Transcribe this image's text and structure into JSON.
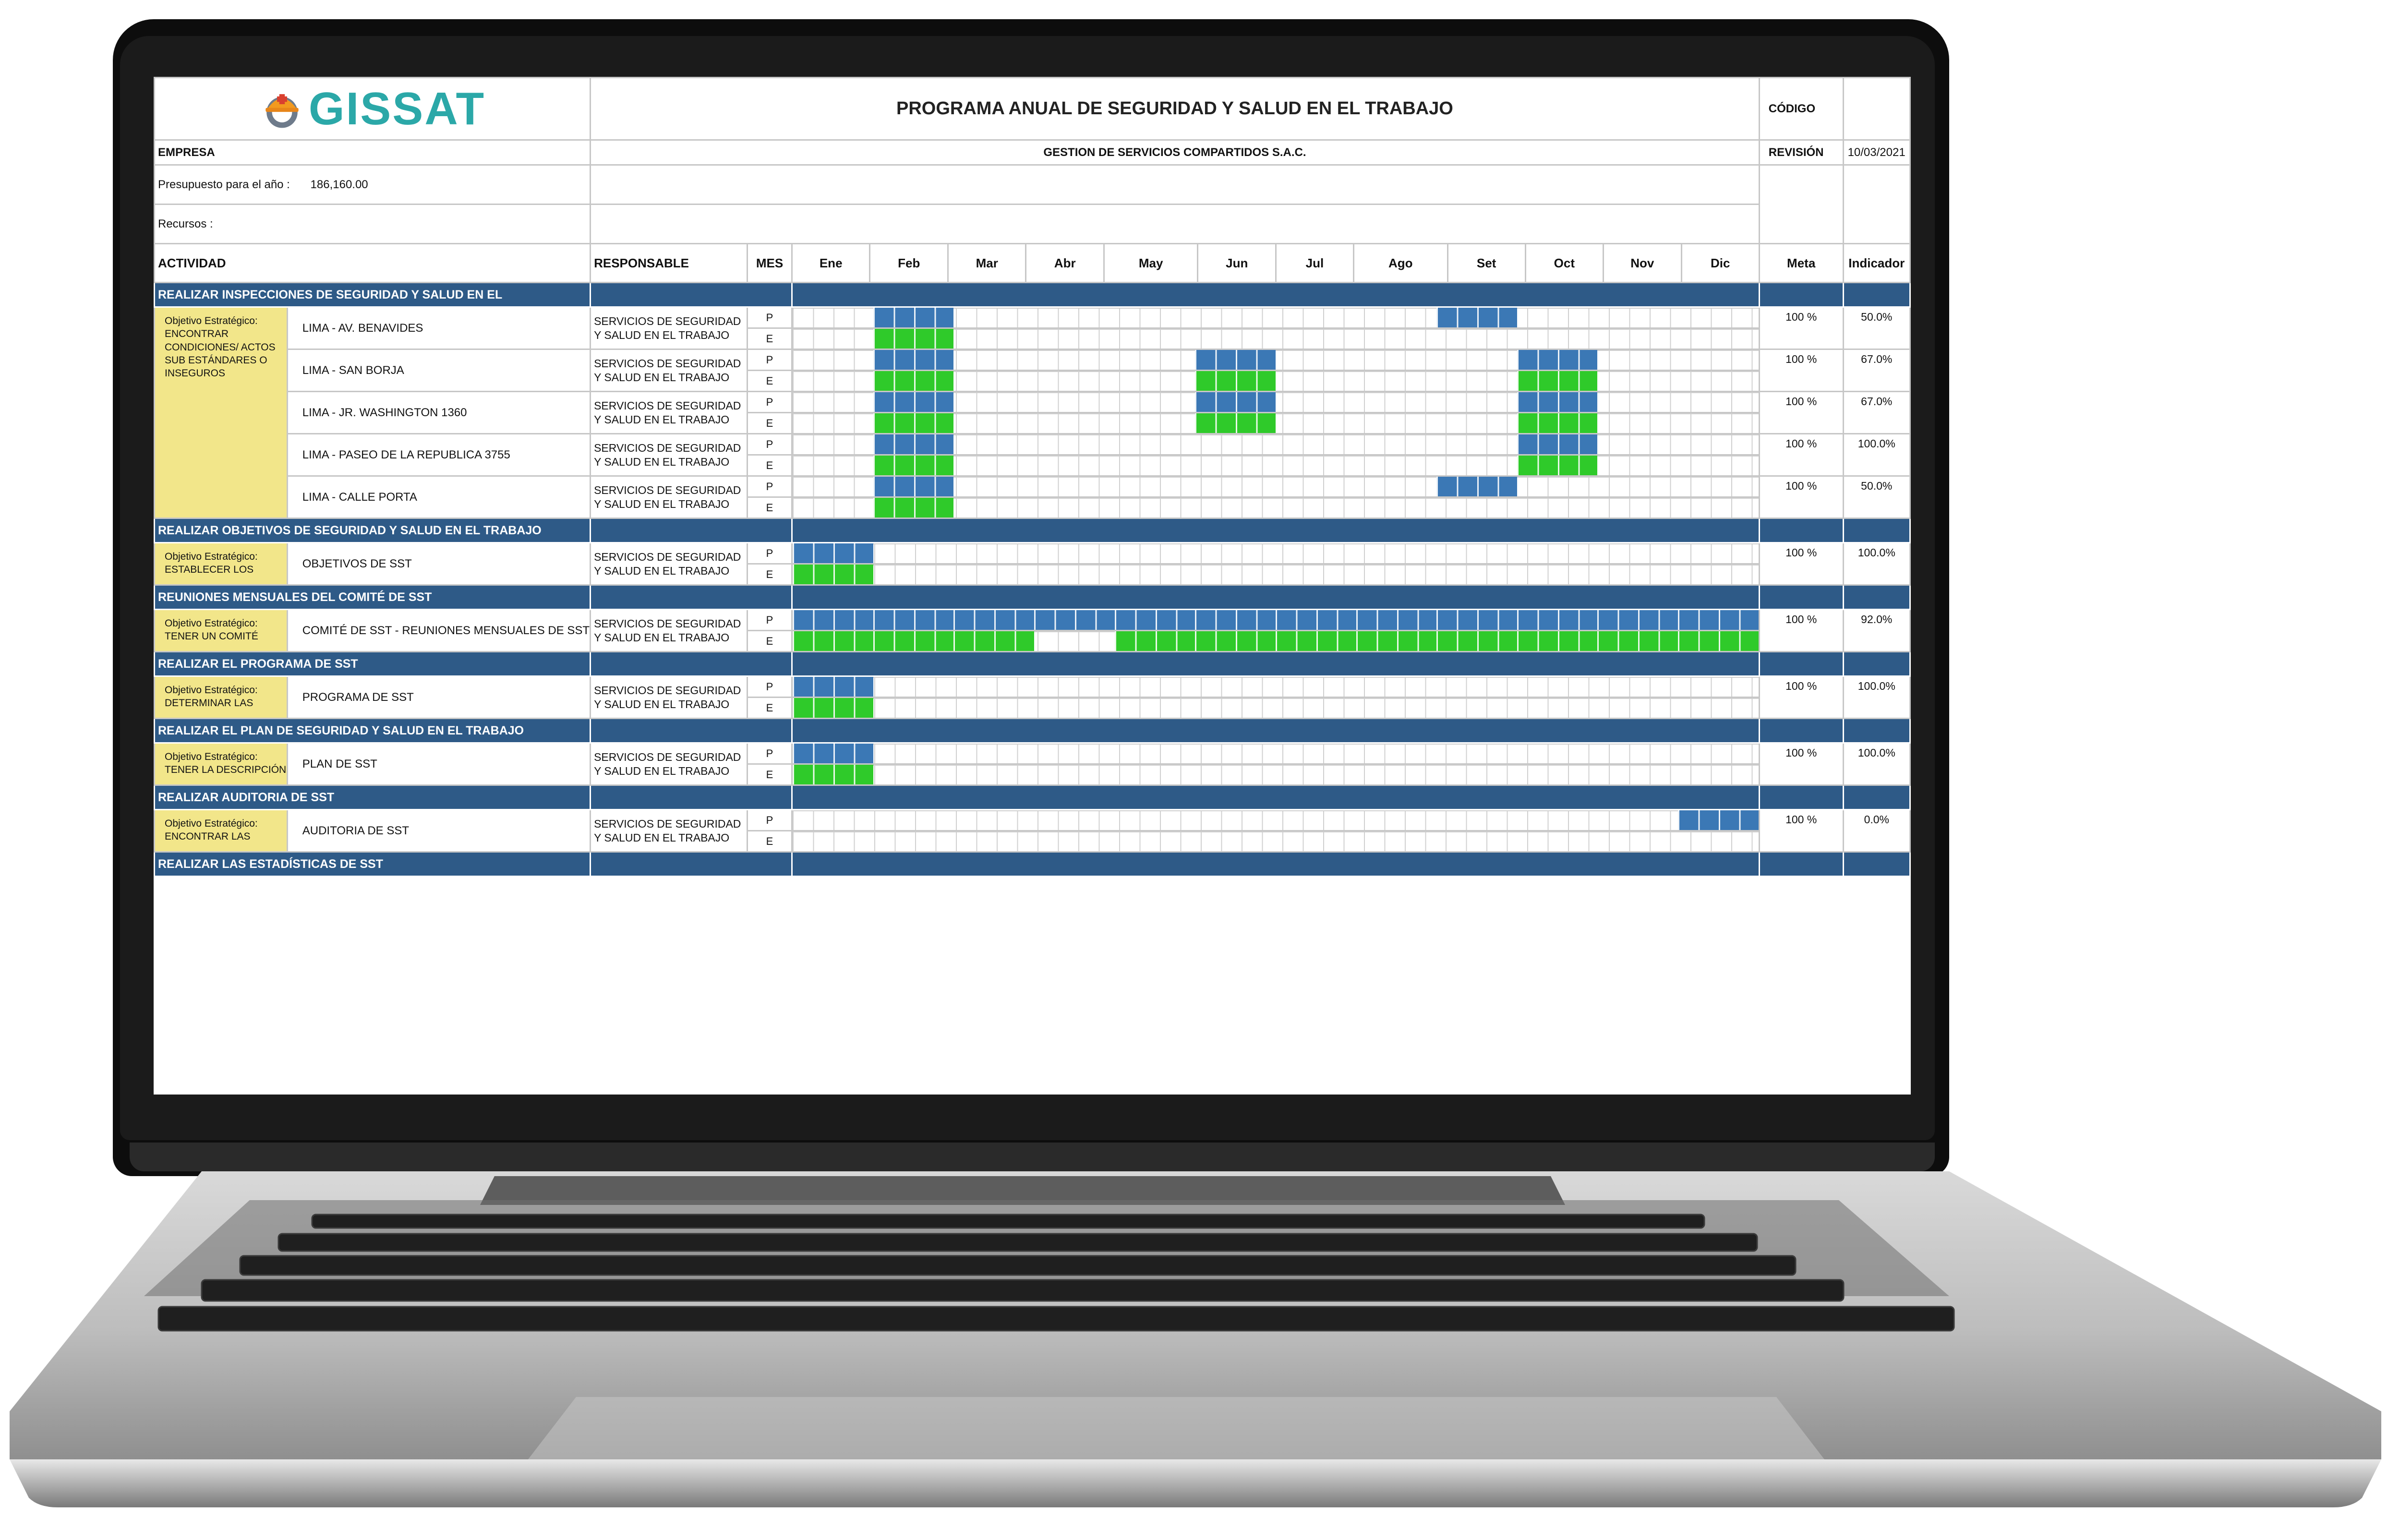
{
  "header": {
    "logo_text": "GISSAT",
    "title": "PROGRAMA ANUAL DE SEGURIDAD Y SALUD EN EL TRABAJO",
    "codigo_label": "CÓDIGO",
    "codigo_value": "",
    "empresa_label": "EMPRESA",
    "empresa_value": "GESTION DE SERVICIOS COMPARTIDOS S.A.C.",
    "revision_label": "REVISIÓN",
    "revision_value": "10/03/2021",
    "presupuesto_label": "Presupuesto para el año :",
    "presupuesto_value": "186,160.00",
    "recursos_label": "Recursos :"
  },
  "columns": {
    "actividad": "ACTIVIDAD",
    "responsable": "RESPONSABLE",
    "mes": "MES",
    "months": [
      "Ene",
      "Feb",
      "Mar",
      "Abr",
      "May",
      "Jun",
      "Jul",
      "Ago",
      "Set",
      "Oct",
      "Nov",
      "Dic"
    ],
    "meta": "Meta",
    "indicador": "Indicador"
  },
  "colors": {
    "section_bg": "#2e5a87",
    "planned": "#3b78b5",
    "executed": "#2fca2a",
    "objective_bg": "#f2e68a",
    "logo": "#2ba8a8"
  },
  "sections": [
    {
      "title": "REALIZAR INSPECCIONES DE SEGURIDAD Y SALUD EN EL",
      "objective": "Objetivo Estratégico: ENCONTRAR CONDICIONES/ ACTOS SUB ESTÁNDARES O INSEGUROS",
      "rows": [
        {
          "activity": "LIMA - AV. BENAVIDES",
          "responsable": "SERVICIOS DE SEGURIDAD Y SALUD EN EL TRABAJO",
          "p_label": "P",
          "e_label": "E",
          "meta": "100 %",
          "indicador": "50.0%",
          "plan": [
            2,
            9
          ],
          "exec": [
            2
          ]
        },
        {
          "activity": "LIMA - SAN BORJA",
          "responsable": "SERVICIOS DE SEGURIDAD Y SALUD EN EL TRABAJO",
          "p_label": "P",
          "e_label": "E",
          "meta": "100 %",
          "indicador": "67.0%",
          "plan": [
            2,
            6,
            10
          ],
          "exec": [
            2,
            6,
            10
          ]
        },
        {
          "activity": "LIMA - JR. WASHINGTON 1360",
          "responsable": "SERVICIOS DE SEGURIDAD Y SALUD EN EL TRABAJO",
          "p_label": "P",
          "e_label": "E",
          "meta": "100 %",
          "indicador": "67.0%",
          "plan": [
            2,
            6,
            10
          ],
          "exec": [
            2,
            6,
            10
          ]
        },
        {
          "activity": "LIMA - PASEO DE LA REPUBLICA 3755",
          "responsable": "SERVICIOS DE SEGURIDAD Y SALUD EN EL TRABAJO",
          "p_label": "P",
          "e_label": "E",
          "meta": "100 %",
          "indicador": "100.0%",
          "plan": [
            2,
            10
          ],
          "exec": [
            2,
            10
          ]
        },
        {
          "activity": "LIMA - CALLE PORTA",
          "responsable": "SERVICIOS DE SEGURIDAD Y SALUD EN EL TRABAJO",
          "p_label": "P",
          "e_label": "E",
          "meta": "100 %",
          "indicador": "50.0%",
          "plan": [
            2,
            9
          ],
          "exec": [
            2
          ]
        }
      ]
    },
    {
      "title": "REALIZAR OBJETIVOS DE SEGURIDAD Y SALUD EN EL TRABAJO",
      "objective": "Objetivo Estratégico: ESTABLECER LOS",
      "rows": [
        {
          "activity": "OBJETIVOS DE SST",
          "responsable": "SERVICIOS DE SEGURIDAD Y SALUD EN EL TRABAJO",
          "p_label": "P",
          "e_label": "E",
          "meta": "100 %",
          "indicador": "100.0%",
          "plan": [
            1
          ],
          "exec": [
            1
          ]
        }
      ]
    },
    {
      "title": "REUNIONES MENSUALES DEL COMITÉ DE SST",
      "objective": "Objetivo Estratégico: TENER UN COMITÉ",
      "rows": [
        {
          "activity": "COMITÉ DE SST - REUNIONES MENSUALES DE SST",
          "responsable": "SERVICIOS DE SEGURIDAD Y SALUD EN EL TRABAJO",
          "p_label": "P",
          "e_label": "E",
          "meta": "100 %",
          "indicador": "92.0%",
          "plan": [
            1,
            2,
            3,
            4,
            5,
            6,
            7,
            8,
            9,
            10,
            11,
            12
          ],
          "exec": [
            1,
            2,
            3,
            5,
            6,
            7,
            8,
            9,
            10,
            11,
            12
          ]
        }
      ]
    },
    {
      "title": "REALIZAR EL PROGRAMA DE SST",
      "objective": "Objetivo Estratégico: DETERMINAR LAS",
      "rows": [
        {
          "activity": "PROGRAMA DE SST",
          "responsable": "SERVICIOS DE SEGURIDAD Y SALUD EN EL TRABAJO",
          "p_label": "P",
          "e_label": "E",
          "meta": "100 %",
          "indicador": "100.0%",
          "plan": [
            1
          ],
          "exec": [
            1
          ]
        }
      ]
    },
    {
      "title": "REALIZAR EL PLAN DE SEGURIDAD Y SALUD EN EL TRABAJO",
      "objective": "Objetivo Estratégico: TENER LA DESCRIPCIÓN",
      "rows": [
        {
          "activity": "PLAN DE SST",
          "responsable": "SERVICIOS DE SEGURIDAD Y SALUD EN EL TRABAJO",
          "p_label": "P",
          "e_label": "E",
          "meta": "100 %",
          "indicador": "100.0%",
          "plan": [
            1
          ],
          "exec": [
            1
          ]
        }
      ]
    },
    {
      "title": "REALIZAR AUDITORIA DE SST",
      "objective": "Objetivo Estratégico: ENCONTRAR LAS",
      "rows": [
        {
          "activity": "AUDITORIA DE SST",
          "responsable": "SERVICIOS DE SEGURIDAD Y SALUD EN EL TRABAJO",
          "p_label": "P",
          "e_label": "E",
          "meta": "100 %",
          "indicador": "0.0%",
          "plan": [
            12
          ],
          "exec": []
        }
      ]
    },
    {
      "title": "REALIZAR LAS ESTADÍSTICAS DE SST",
      "objective": "",
      "rows": []
    }
  ]
}
